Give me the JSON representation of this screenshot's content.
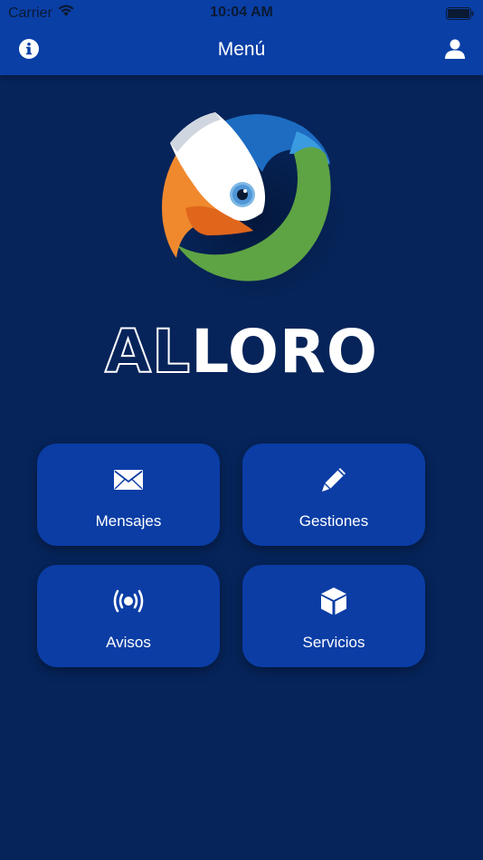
{
  "status": {
    "carrier": "Carrier",
    "time": "10:04 AM"
  },
  "nav": {
    "title": "Menú",
    "left_icon": "info-icon",
    "right_icon": "user-icon"
  },
  "brand": {
    "outline_part": "AL",
    "solid_part": "LORO"
  },
  "menu": [
    {
      "label": "Mensajes",
      "icon": "envelope-icon"
    },
    {
      "label": "Gestiones",
      "icon": "pencil-icon"
    },
    {
      "label": "Avisos",
      "icon": "broadcast-icon"
    },
    {
      "label": "Servicios",
      "icon": "box-icon"
    }
  ],
  "colors": {
    "background": "#06245a",
    "header": "#0a3fa6",
    "tile": "#0b3da5",
    "logo_orange": "#f0892e",
    "logo_green": "#5ea344",
    "logo_blue": "#1d6cc2"
  }
}
